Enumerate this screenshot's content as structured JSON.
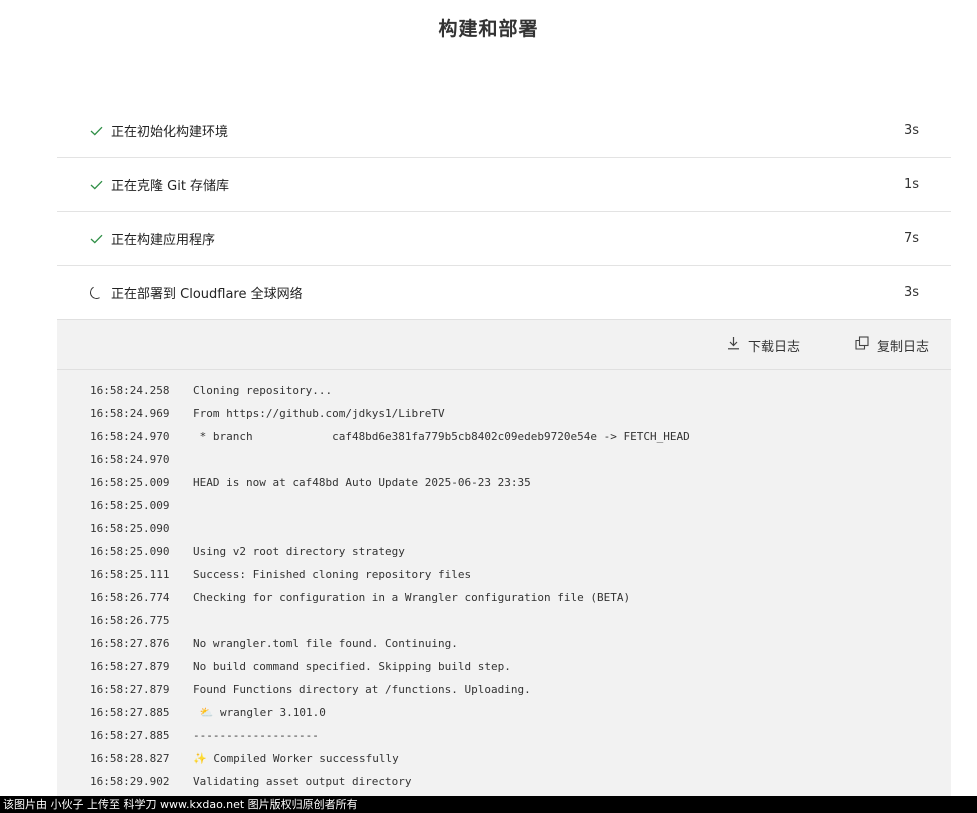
{
  "page_title": "构建和部署",
  "steps": [
    {
      "label": "正在初始化构建环境",
      "duration": "3s",
      "status": "done",
      "icon": "check-icon"
    },
    {
      "label": "正在克隆 Git 存储库",
      "duration": "1s",
      "status": "done",
      "icon": "check-icon"
    },
    {
      "label": "正在构建应用程序",
      "duration": "7s",
      "status": "done",
      "icon": "check-icon"
    },
    {
      "label": "正在部署到 Cloudflare 全球网络",
      "duration": "3s",
      "status": "in-progress",
      "icon": "spinner-icon"
    }
  ],
  "toolbar": {
    "download_label": "下载日志",
    "copy_label": "复制日志"
  },
  "log": [
    {
      "ts": "16:58:24.258",
      "msg": "Cloning repository..."
    },
    {
      "ts": "16:58:24.969",
      "msg": "From https://github.com/jdkys1/LibreTV"
    },
    {
      "ts": "16:58:24.970",
      "msg": " * branch            caf48bd6e381fa779b5cb8402c09edeb9720e54e -> FETCH_HEAD"
    },
    {
      "ts": "16:58:24.970",
      "msg": ""
    },
    {
      "ts": "16:58:25.009",
      "msg": "HEAD is now at caf48bd Auto Update 2025-06-23 23:35"
    },
    {
      "ts": "16:58:25.009",
      "msg": ""
    },
    {
      "ts": "16:58:25.090",
      "msg": ""
    },
    {
      "ts": "16:58:25.090",
      "msg": "Using v2 root directory strategy"
    },
    {
      "ts": "16:58:25.111",
      "msg": "Success: Finished cloning repository files"
    },
    {
      "ts": "16:58:26.774",
      "msg": "Checking for configuration in a Wrangler configuration file (BETA)"
    },
    {
      "ts": "16:58:26.775",
      "msg": ""
    },
    {
      "ts": "16:58:27.876",
      "msg": "No wrangler.toml file found. Continuing."
    },
    {
      "ts": "16:58:27.879",
      "msg": "No build command specified. Skipping build step."
    },
    {
      "ts": "16:58:27.879",
      "msg": "Found Functions directory at /functions. Uploading."
    },
    {
      "ts": "16:58:27.885",
      "msg": " ⛅️ wrangler 3.101.0"
    },
    {
      "ts": "16:58:27.885",
      "msg": "-------------------"
    },
    {
      "ts": "16:58:28.827",
      "msg": "✨ Compiled Worker successfully"
    },
    {
      "ts": "16:58:29.902",
      "msg": "Validating asset output directory"
    }
  ],
  "watermark": "该图片由 小伙子 上传至 科学刀 www.kxdao.net 图片版权归原创者所有",
  "colors": {
    "check": "#2f8f46",
    "log_bg": "#f2f2f2",
    "divider": "#e3e3e3"
  }
}
